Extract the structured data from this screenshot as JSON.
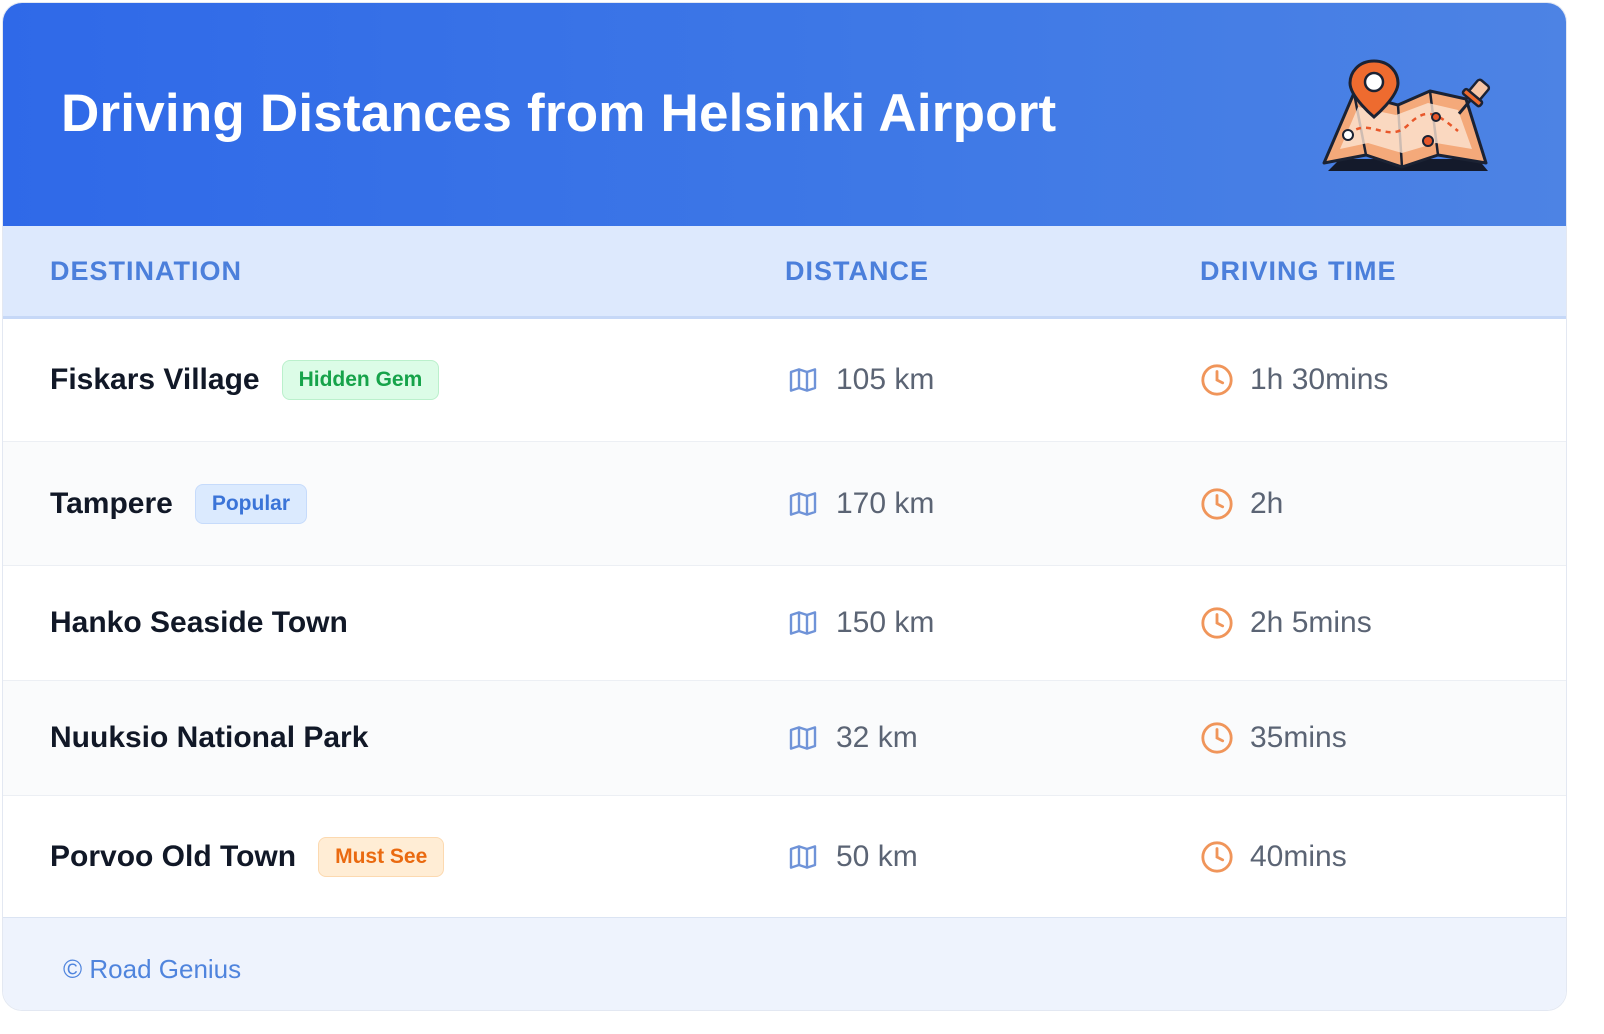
{
  "header": {
    "title": "Driving Distances from Helsinki Airport",
    "illustration_icon": "map-with-pin-icon"
  },
  "table": {
    "columns": [
      "DESTINATION",
      "DISTANCE",
      "DRIVING TIME"
    ],
    "rows": [
      {
        "destination": "Fiskars Village",
        "badge": "Hidden Gem",
        "distance": "105 km",
        "time": "1h 30mins"
      },
      {
        "destination": "Tampere",
        "badge": "Popular",
        "distance": "170 km",
        "time": "2h"
      },
      {
        "destination": "Hanko Seaside Town",
        "badge": "",
        "distance": "150 km",
        "time": "2h 5mins"
      },
      {
        "destination": "Nuuksio National Park",
        "badge": "",
        "distance": "32 km",
        "time": "35mins"
      },
      {
        "destination": "Porvoo Old Town",
        "badge": "Must See",
        "distance": "50 km",
        "time": "40mins"
      }
    ]
  },
  "footer": {
    "copyright": "© Road Genius"
  },
  "colors": {
    "header_start": "#2f69e8",
    "header_end": "#4d83e4",
    "table_head_bg": "#dde9fd",
    "table_head_text": "#4b7fdb",
    "map_icon": "#6f93d8",
    "clock_icon": "#f0955a",
    "badge_gem": "#16a34a",
    "badge_popular": "#3b74d8",
    "badge_must_see": "#ea6a10"
  }
}
